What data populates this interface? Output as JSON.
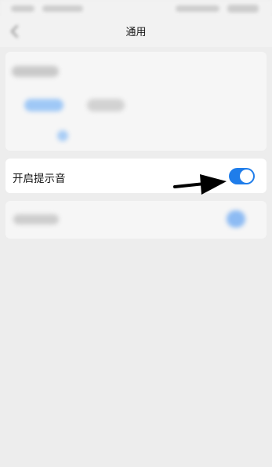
{
  "nav": {
    "title": "通用",
    "back_icon": "chevron-left-icon"
  },
  "settings": {
    "notification_sound": {
      "label": "开启提示音",
      "enabled": true
    }
  },
  "colors": {
    "accent": "#1f7dea",
    "background": "#ededed",
    "card": "#ffffff",
    "annotation_arrow": "#000000"
  },
  "annotation": {
    "icon": "arrow-right-icon"
  }
}
